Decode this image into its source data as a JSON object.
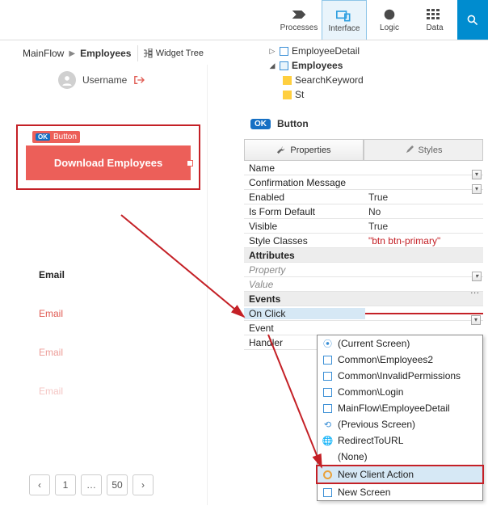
{
  "toolbar": {
    "processes": "Processes",
    "interface": "Interface",
    "logic": "Logic",
    "data": "Data"
  },
  "breadcrumb": {
    "root": "MainFlow",
    "current": "Employees"
  },
  "widget_tree_label": "Widget Tree",
  "user": {
    "name": "Username"
  },
  "button_badge": "Button",
  "big_button_label": "Download Employees",
  "email_header": "Email",
  "email_cell": "Email",
  "pager": {
    "prev": "‹",
    "p1": "1",
    "dots": "…",
    "p50": "50",
    "next": "›"
  },
  "tree": {
    "n1": "EmployeeDetail",
    "n2": "Employees",
    "n3": "SearchKeyword",
    "n4_prefix": "St"
  },
  "ok_label": "OK",
  "ok_title": "Button",
  "ptabs": {
    "props": "Properties",
    "styles": "Styles"
  },
  "props": {
    "name_k": "Name",
    "conf_k": "Confirmation Message",
    "enabled_k": "Enabled",
    "enabled_v": "True",
    "form_k": "Is Form Default",
    "form_v": "No",
    "visible_k": "Visible",
    "visible_v": "True",
    "style_k": "Style Classes",
    "style_v": "\"btn btn-primary\"",
    "attrs_head": "Attributes",
    "prop_k": "Property",
    "val_k": "Value",
    "events_head": "Events",
    "onclick_k": "On Click",
    "event_k": "Event",
    "handler_k": "Handler"
  },
  "menu": {
    "m1": "(Current Screen)",
    "m2": "Common\\Employees2",
    "m3": "Common\\InvalidPermissions",
    "m4": "Common\\Login",
    "m5": "MainFlow\\EmployeeDetail",
    "m6": "(Previous Screen)",
    "m7": "RedirectToURL",
    "m8": "(None)",
    "m9": "New Client Action",
    "m10": "New Screen"
  }
}
